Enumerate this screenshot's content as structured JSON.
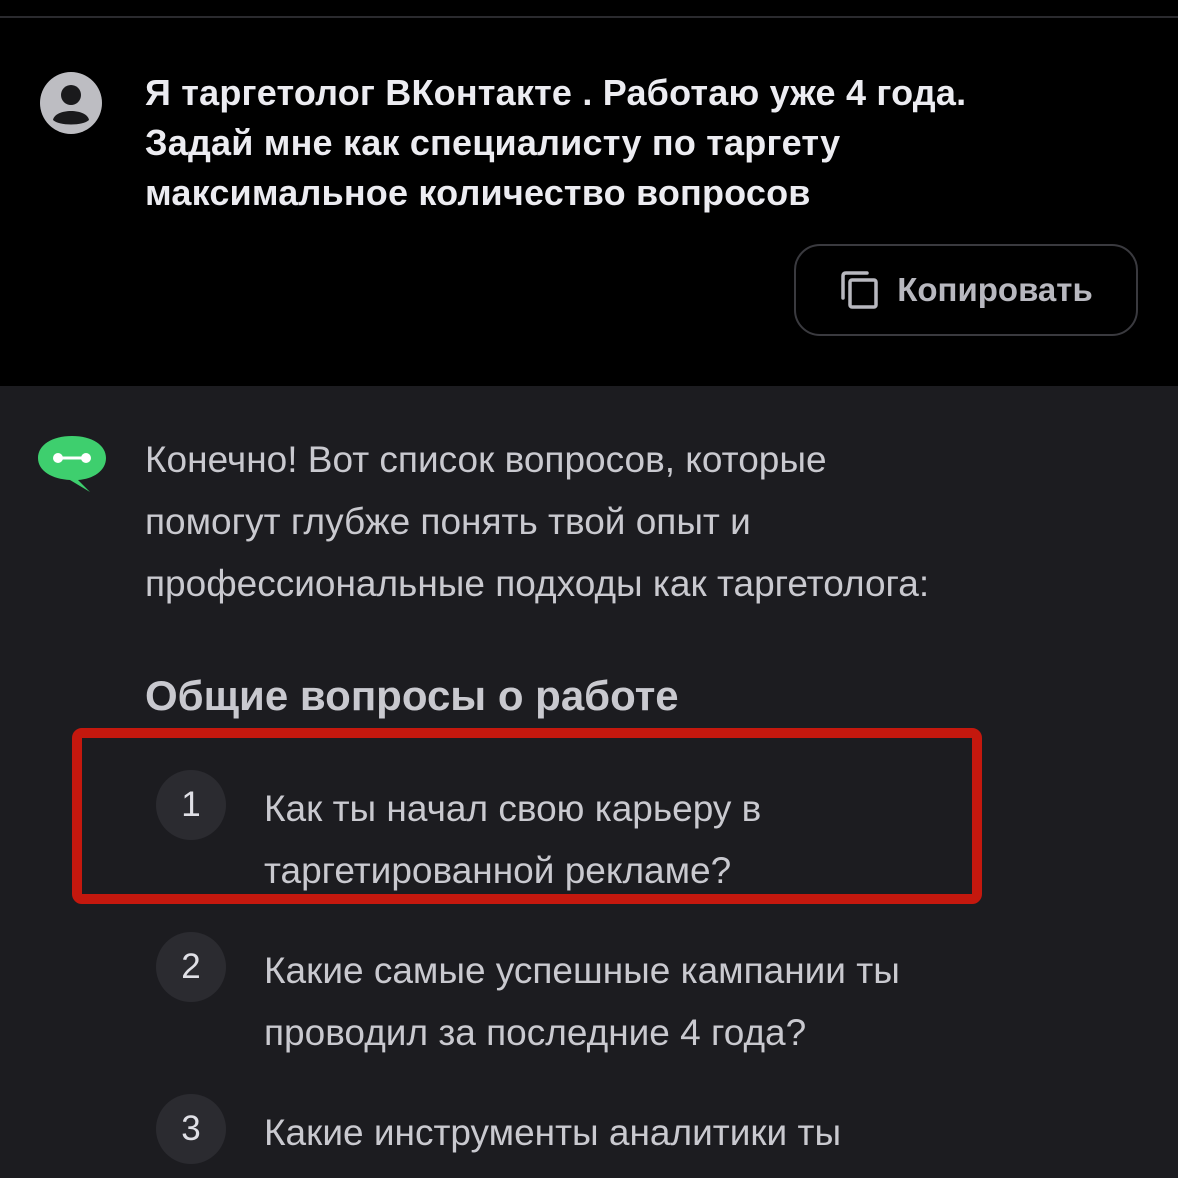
{
  "user_message": {
    "lines": [
      "Я таргетолог ВКонтакте . Работаю уже 4 года.",
      "Задай мне как специалисту по таргету",
      "максимальное количество вопросов"
    ],
    "copy_label": "Копировать"
  },
  "assistant_message": {
    "intro_lines": [
      "Конечно! Вот список вопросов, которые",
      "помогут глубже понять твой опыт и",
      "профессиональные подходы как таргетолога:"
    ],
    "section_heading": "Общие вопросы о работе",
    "items": [
      {
        "number": "1",
        "lines": [
          "Как ты начал свою карьеру в",
          "таргетированной рекламе?"
        ]
      },
      {
        "number": "2",
        "lines": [
          "Какие самые успешные кампании ты",
          "проводил за последние 4 года?"
        ]
      },
      {
        "number": "3",
        "lines": [
          "Какие инструменты аналитики ты",
          ""
        ]
      }
    ]
  },
  "colors": {
    "highlight": "#c4180e",
    "assistant_icon": "#3ecf6e",
    "background_user": "#000000",
    "background_assistant": "#1c1c20"
  }
}
